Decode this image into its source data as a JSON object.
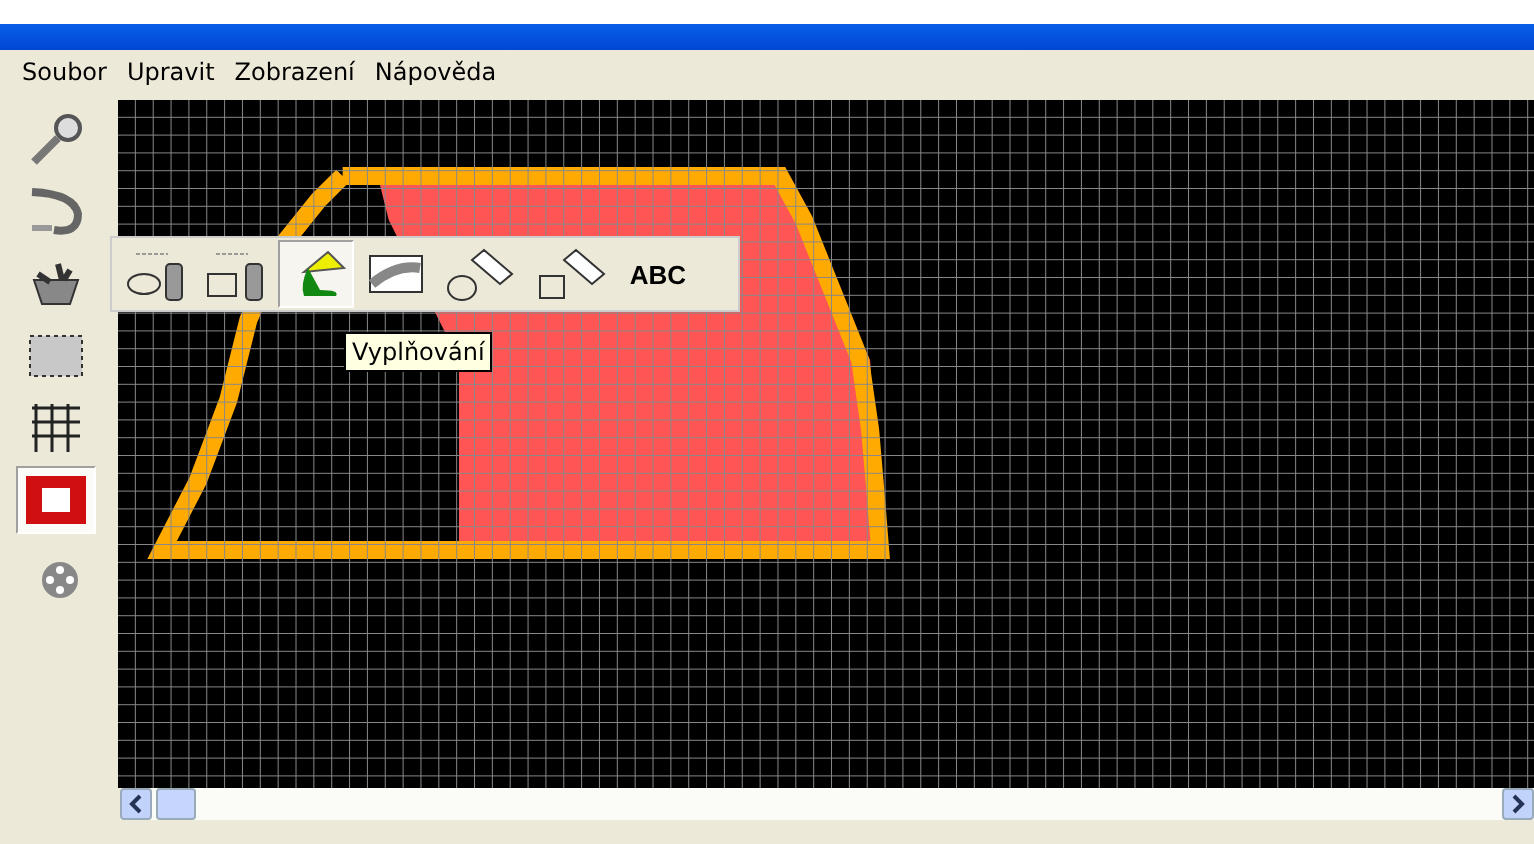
{
  "menu": [
    "Soubor",
    "Upravit",
    "Zobrazení",
    "Nápověda"
  ],
  "tools": [
    {
      "kind": "magnifier",
      "selected": false
    },
    {
      "kind": "brush",
      "selected": false
    },
    {
      "kind": "basket",
      "selected": false
    },
    {
      "kind": "selection",
      "selected": false
    },
    {
      "kind": "grid",
      "selected": false
    },
    {
      "kind": "frame",
      "selected": true
    },
    {
      "kind": "reel",
      "selected": false
    }
  ],
  "popup_tools": [
    {
      "kind": "spray-ellipse",
      "selected": false
    },
    {
      "kind": "spray-rect",
      "selected": false
    },
    {
      "kind": "fill",
      "selected": true
    },
    {
      "kind": "gradient",
      "selected": false
    },
    {
      "kind": "eraser-ellipse",
      "selected": false
    },
    {
      "kind": "eraser-rect",
      "selected": false
    },
    {
      "kind": "text",
      "label": "ABC",
      "selected": false
    }
  ],
  "tooltip": "Vyplňování"
}
